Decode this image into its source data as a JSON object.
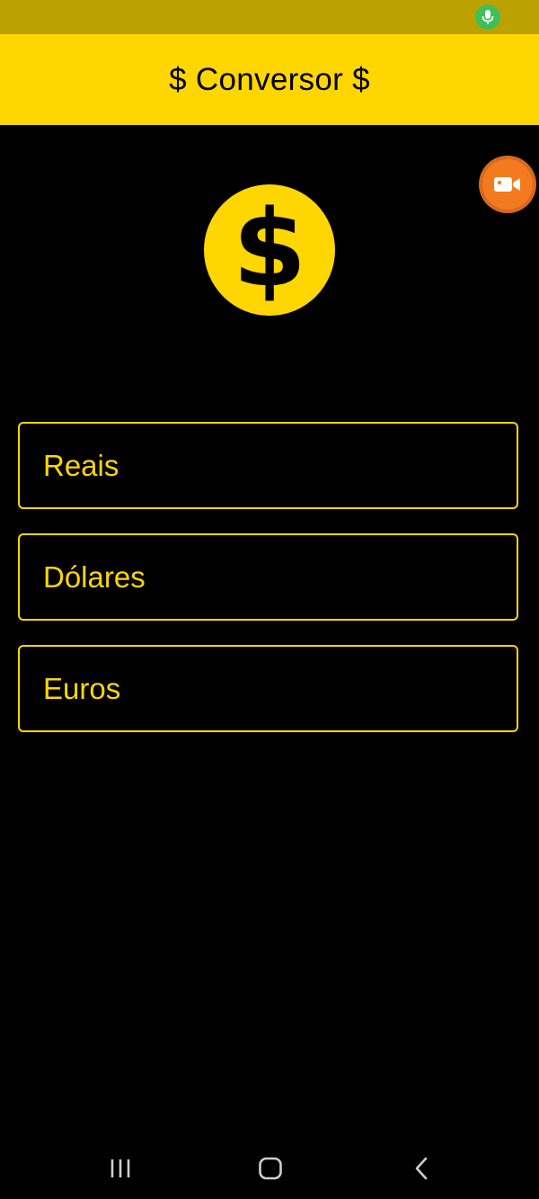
{
  "app": {
    "title": "$ Conversor $"
  },
  "fields": [
    {
      "label": "Reais",
      "value": ""
    },
    {
      "label": "Dólares",
      "value": ""
    },
    {
      "label": "Euros",
      "value": ""
    }
  ],
  "colors": {
    "accent": "#ffd600",
    "status_bar": "#bca200",
    "background": "#000000",
    "record_button": "#f47a20",
    "mic_indicator": "#3fbf5a"
  },
  "icons": {
    "main": "dollar-coin-icon",
    "status": "microphone-icon",
    "floating": "video-camera-icon",
    "nav": [
      "recents-icon",
      "home-icon",
      "back-icon"
    ]
  }
}
